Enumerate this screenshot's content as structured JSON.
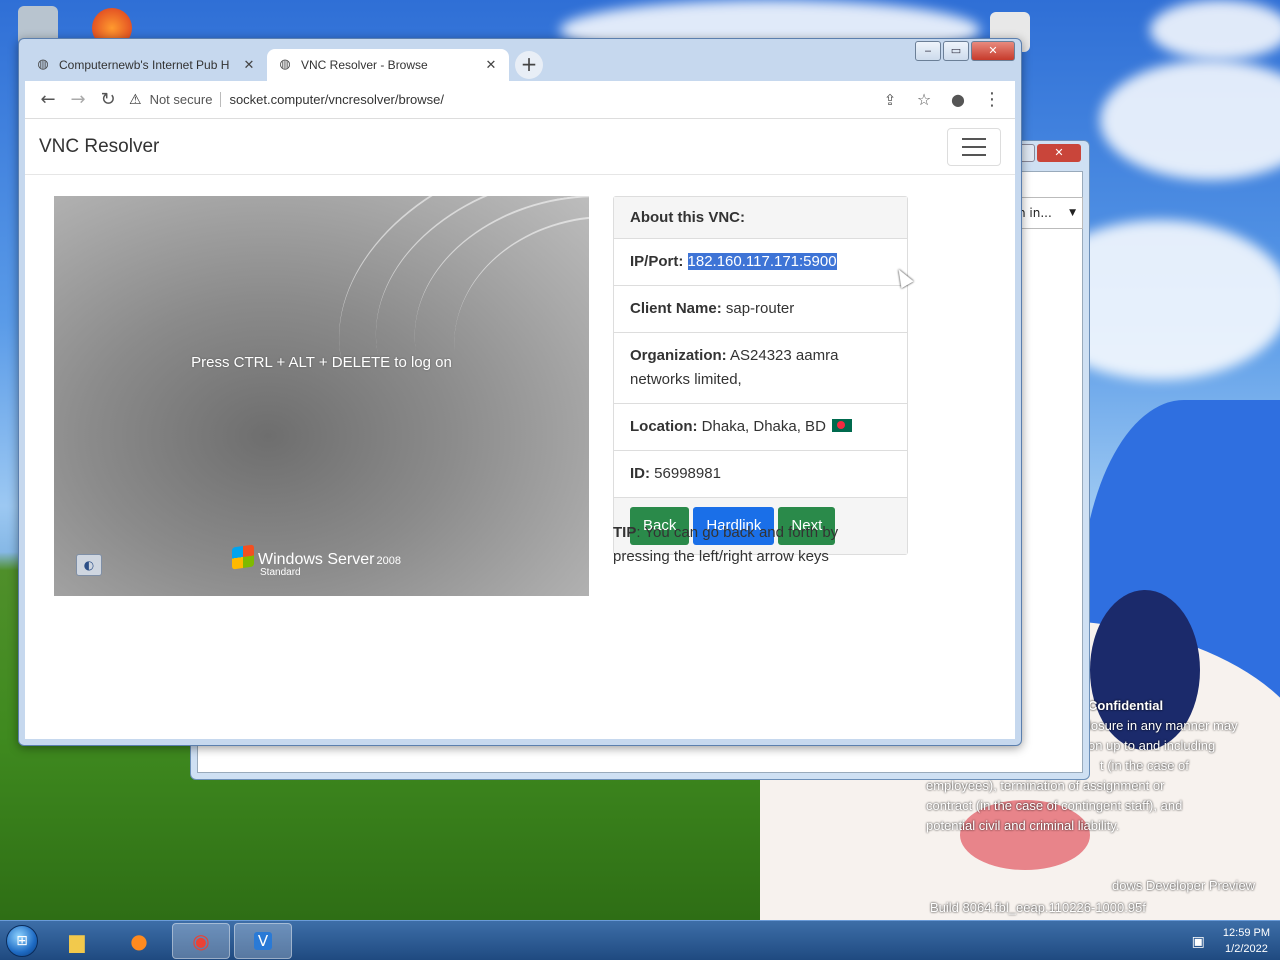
{
  "browser": {
    "tabs": [
      {
        "title": "Computernewb's Internet Pub H",
        "active": false
      },
      {
        "title": "VNC Resolver - Browse",
        "active": true
      }
    ],
    "address": {
      "security_label": "Not secure",
      "url": "socket.computer/vncresolver/browse/"
    }
  },
  "page": {
    "brand": "VNC Resolver",
    "vnc_screen": {
      "message": "Press CTRL + ALT + DELETE to log on",
      "os_logo": "Windows Server",
      "os_version": "2008",
      "os_edition": "Standard"
    },
    "card": {
      "heading": "About this VNC:",
      "ip_label": "IP/Port:",
      "ip_value": "182.160.117.171:5900",
      "client_label": "Client Name:",
      "client_value": "sap-router",
      "org_label": "Organization:",
      "org_value": "AS24323 aamra networks limited,",
      "location_label": "Location:",
      "location_value": "Dhaka, Dhaka, BD",
      "id_label": "ID:",
      "id_value": "56998981",
      "buttons": {
        "back": "Back",
        "hardlink": "Hardlink",
        "next": "Next"
      }
    },
    "tip": {
      "label": "TIP",
      "text": ": You can go back and forth by pressing the left/right arrow keys"
    }
  },
  "back_window": {
    "dropdown_text": "n in..."
  },
  "desktop": {
    "overlay_lines": [
      "Confidential",
      "losure in any manner may",
      "on up to and including",
      "t (in the case of",
      "employees), termination of assignment or",
      "contract (in the case of contingent staff), and",
      "potential civil and criminal liability."
    ],
    "watermark_1": "dows Developer Preview",
    "watermark_2": "Build 8064.fbl_eeap.110226-1000.95f"
  },
  "taskbar": {
    "time": "12:59 PM",
    "date": "1/2/2022"
  },
  "colors": {
    "btn_green": "#2a8a4a",
    "btn_blue": "#1a6fe8",
    "selection": "#3e74d6"
  }
}
